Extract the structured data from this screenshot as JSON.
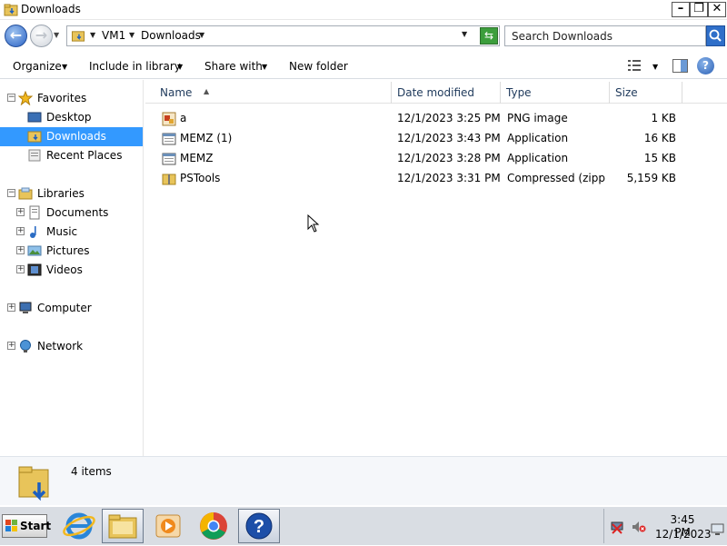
{
  "window": {
    "title": "Downloads"
  },
  "address": {
    "crumbs": [
      "VM1",
      "Downloads"
    ],
    "search_placeholder": "Search Downloads"
  },
  "toolbar": {
    "organize": "Organize",
    "include_in_library": "Include in library",
    "share_with": "Share with",
    "new_folder": "New folder"
  },
  "nav": {
    "favorites": "Favorites",
    "desktop": "Desktop",
    "downloads": "Downloads",
    "recent_places": "Recent Places",
    "libraries": "Libraries",
    "documents": "Documents",
    "music": "Music",
    "pictures": "Pictures",
    "videos": "Videos",
    "computer": "Computer",
    "network": "Network"
  },
  "columns": {
    "name": "Name",
    "date_modified": "Date modified",
    "type": "Type",
    "size": "Size"
  },
  "files": [
    {
      "name": "a",
      "date": "12/1/2023 3:25 PM",
      "type": "PNG image",
      "size": "1 KB",
      "icon": "image-file-icon"
    },
    {
      "name": "MEMZ (1)",
      "date": "12/1/2023 3:43 PM",
      "type": "Application",
      "size": "16 KB",
      "icon": "application-icon"
    },
    {
      "name": "MEMZ",
      "date": "12/1/2023 3:28 PM",
      "type": "Application",
      "size": "15 KB",
      "icon": "application-icon"
    },
    {
      "name": "PSTools",
      "date": "12/1/2023 3:31 PM",
      "type": "Compressed (zipp...",
      "size": "5,159 KB",
      "icon": "zip-folder-icon"
    }
  ],
  "details": {
    "item_count": "4 items"
  },
  "taskbar": {
    "start": "Start",
    "clock_time": "3:45 PM",
    "clock_date": "12/1/2023"
  },
  "colors": {
    "selection": "#3399ff",
    "header_text": "#1e395b"
  }
}
